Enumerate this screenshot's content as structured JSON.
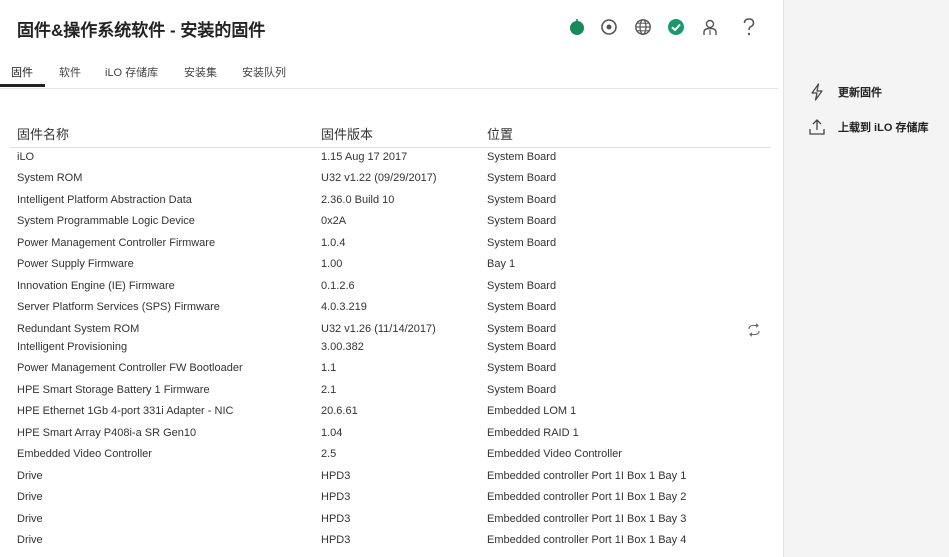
{
  "page": {
    "title": "固件&操作系统软件 - 安装的固件"
  },
  "header_icons": [
    {
      "name": "health-status-icon",
      "color": "#1a8a5a"
    },
    {
      "name": "locator-icon"
    },
    {
      "name": "language-globe-icon"
    },
    {
      "name": "ok-status-icon",
      "color": "#1a9a6a"
    },
    {
      "name": "user-icon"
    },
    {
      "name": "help-icon"
    }
  ],
  "tabs": [
    {
      "label": "固件",
      "active": true
    },
    {
      "label": "软件"
    },
    {
      "label": "iLO 存储库"
    },
    {
      "label": "安装集"
    },
    {
      "label": "安装队列"
    }
  ],
  "table": {
    "columns": [
      "固件名称",
      "固件版本",
      "位置"
    ],
    "rows": [
      {
        "name": "iLO",
        "version": "1.15 Aug 17 2017",
        "location": "System Board"
      },
      {
        "name": "System ROM",
        "version": "U32 v1.22 (09/29/2017)",
        "location": "System Board"
      },
      {
        "name": "Intelligent Platform Abstraction Data",
        "version": "2.36.0 Build 10",
        "location": "System Board"
      },
      {
        "name": "System Programmable Logic Device",
        "version": "0x2A",
        "location": "System Board"
      },
      {
        "name": "Power Management Controller Firmware",
        "version": "1.0.4",
        "location": "System Board"
      },
      {
        "name": "Power Supply Firmware",
        "version": "1.00",
        "location": "Bay 1"
      },
      {
        "name": "Innovation Engine (IE) Firmware",
        "version": "0.1.2.6",
        "location": "System Board"
      },
      {
        "name": "Server Platform Services (SPS) Firmware",
        "version": "4.0.3.219",
        "location": "System Board"
      },
      {
        "name": "Redundant System ROM",
        "version": "U32 v1.26 (11/14/2017)",
        "location": "System Board",
        "action_icon": "swap-rom-icon"
      },
      {
        "name": "Intelligent Provisioning",
        "version": "3.00.382",
        "location": "System Board"
      },
      {
        "name": "Power Management Controller FW Bootloader",
        "version": "1.1",
        "location": "System Board"
      },
      {
        "name": "HPE Smart Storage Battery 1 Firmware",
        "version": "2.1",
        "location": "System Board"
      },
      {
        "name": "HPE Ethernet 1Gb 4-port 331i Adapter - NIC",
        "version": "20.6.61",
        "location": "Embedded LOM 1"
      },
      {
        "name": "HPE Smart Array P408i-a SR Gen10",
        "version": "1.04",
        "location": "Embedded RAID 1"
      },
      {
        "name": "Embedded Video Controller",
        "version": "2.5",
        "location": "Embedded Video Controller"
      },
      {
        "name": "Drive",
        "version": "HPD3",
        "location": "Embedded controller Port 1I Box 1 Bay 1"
      },
      {
        "name": "Drive",
        "version": "HPD3",
        "location": "Embedded controller Port 1I Box 1 Bay 2"
      },
      {
        "name": "Drive",
        "version": "HPD3",
        "location": "Embedded controller Port 1I Box 1 Bay 3"
      },
      {
        "name": "Drive",
        "version": "HPD3",
        "location": "Embedded controller Port 1I Box 1 Bay 4"
      }
    ]
  },
  "side_actions": [
    {
      "label": "更新固件",
      "icon": "flash-icon"
    },
    {
      "label": "上载到 iLO 存储库",
      "icon": "upload-icon"
    }
  ]
}
